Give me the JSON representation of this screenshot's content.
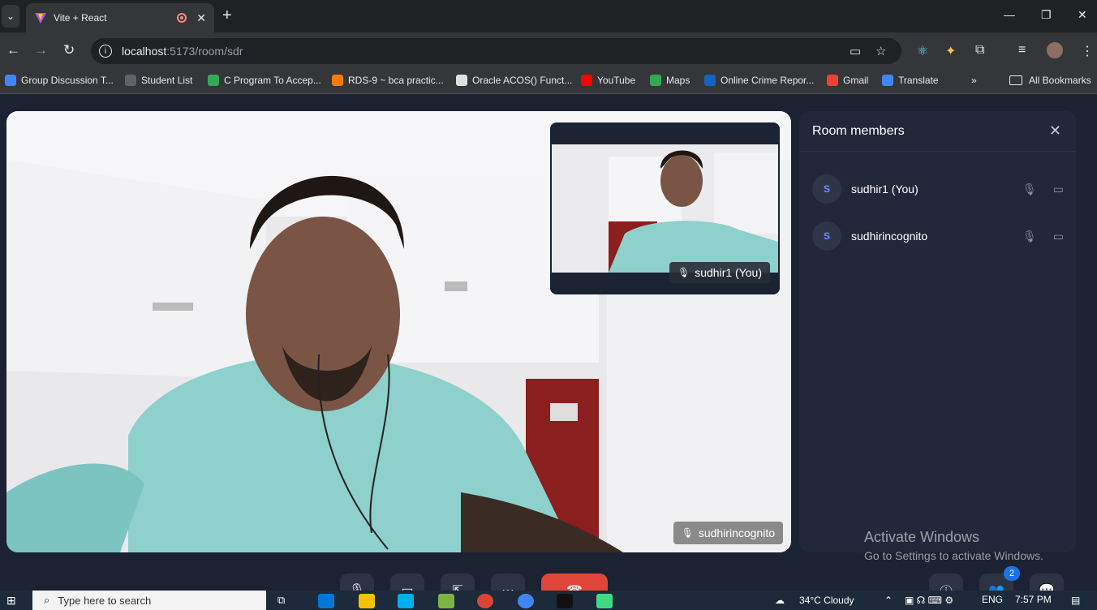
{
  "browser": {
    "tab_title": "Vite + React",
    "url_host": "localhost",
    "url_path": ":5173/room/sdr",
    "bookmarks": [
      {
        "label": "Group Discussion T...",
        "color": "#4285f4"
      },
      {
        "label": "Student List",
        "color": "#5f6368"
      },
      {
        "label": "C Program To Accep...",
        "color": "#34a853"
      },
      {
        "label": "RDS-9 ~ bca practic...",
        "color": "#f57c00"
      },
      {
        "label": "Oracle ACOS() Funct...",
        "color": "#e0e0e0"
      },
      {
        "label": "YouTube",
        "color": "#ff0000"
      },
      {
        "label": "Maps",
        "color": "#34a853"
      },
      {
        "label": "Online Crime Repor...",
        "color": "#1565c0"
      },
      {
        "label": "Gmail",
        "color": "#ea4335"
      },
      {
        "label": "Translate",
        "color": "#4285f4"
      }
    ],
    "all_bookmarks": "All Bookmarks"
  },
  "room": {
    "main_participant": "sudhirincognito",
    "self_participant": "sudhir1 (You)",
    "members_title": "Room members",
    "members": [
      {
        "initial": "S",
        "name": "sudhir1 (You)"
      },
      {
        "initial": "S",
        "name": "sudhirincognito"
      }
    ],
    "members_count_badge": "2"
  },
  "watermark": {
    "title": "Activate Windows",
    "subtitle": "Go to Settings to activate Windows."
  },
  "taskbar": {
    "search_placeholder": "Type here to search",
    "weather": "34°C  Cloudy",
    "language": "ENG",
    "time": "7:57 PM"
  },
  "colors": {
    "app_bg": "#1b2231",
    "panel_bg": "#222839",
    "end_call": "#e0453a",
    "accent": "#1a73e8"
  }
}
